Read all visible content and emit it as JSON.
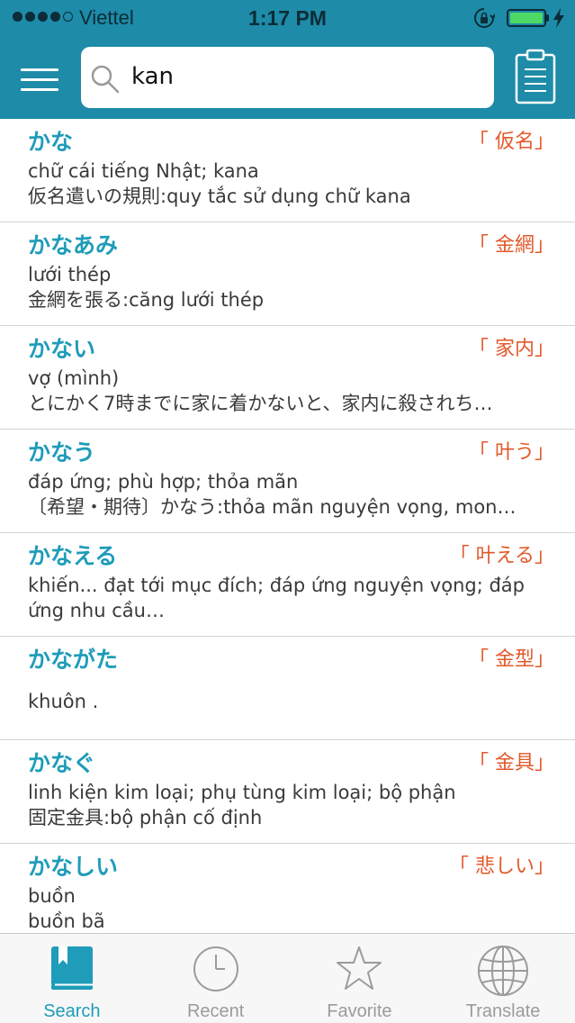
{
  "status_bar": {
    "carrier": "Viettel",
    "time": "1:17 PM",
    "signal_bars_filled": 4,
    "signal_bars_total": 5,
    "battery_level": 1.0
  },
  "header": {
    "search_value": "kan",
    "menu_icon": "hamburger-menu-icon",
    "clipboard_icon": "clipboard-icon"
  },
  "colors": {
    "header_background": "#1e8ba8",
    "word": "#1e9cb9",
    "kanji": "#e2592a",
    "active_tab": "#1e9cb9",
    "inactive_tab": "#9b9b9b"
  },
  "entries": [
    {
      "word": "かな",
      "kanji": "「 仮名」",
      "meaning": "chữ cái tiếng Nhật; kana",
      "example": "仮名遣いの規則:quy tắc sử dụng chữ kana"
    },
    {
      "word": "かなあみ",
      "kanji": "「 金網」",
      "meaning": "lưới thép",
      "example": "金網を張る:căng lưới thép"
    },
    {
      "word": "かない",
      "kanji": "「 家内」",
      "meaning": "vợ (mình)",
      "example": "とにかく7時までに家に着かないと、家内に殺されち…"
    },
    {
      "word": "かなう",
      "kanji": "「 叶う」",
      "meaning": "đáp ứng; phù hợp; thỏa mãn",
      "example": "〔希望・期待〕かなう:thỏa mãn nguyện vọng, mon…"
    },
    {
      "word": "かなえる",
      "kanji": "「 叶える」",
      "meaning": "khiến... đạt tới mục đích; đáp ứng nguyện vọng; đáp ứng nhu cầu…",
      "example": ""
    },
    {
      "word": "かながた",
      "kanji": "「 金型」",
      "meaning": "khuôn .",
      "example": ""
    },
    {
      "word": "かなぐ",
      "kanji": "「 金具」",
      "meaning": "linh kiện kim loại; phụ tùng kim loại; bộ phận",
      "example": "固定金具:bộ phận cố định"
    },
    {
      "word": "かなしい",
      "kanji": "「 悲しい」",
      "meaning": "buồn",
      "example": "buồn bã"
    }
  ],
  "tabs": [
    {
      "label": "Search",
      "icon": "book-icon",
      "active": true
    },
    {
      "label": "Recent",
      "icon": "clock-icon",
      "active": false
    },
    {
      "label": "Favorite",
      "icon": "star-icon",
      "active": false
    },
    {
      "label": "Translate",
      "icon": "globe-icon",
      "active": false
    }
  ]
}
